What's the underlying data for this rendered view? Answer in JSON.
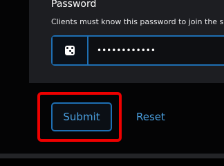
{
  "form": {
    "password_label": "Password",
    "password_help": "Clients must know this password to join the s",
    "password_value": "••••••••••••",
    "generate_icon": "dice-icon"
  },
  "actions": {
    "submit_label": "Submit",
    "reset_label": "Reset"
  },
  "colors": {
    "accent": "#1e6fb3",
    "link": "#4a9fdf",
    "highlight": "#ee0000",
    "card_background": "#1d1e22",
    "page_background": "#040405"
  }
}
